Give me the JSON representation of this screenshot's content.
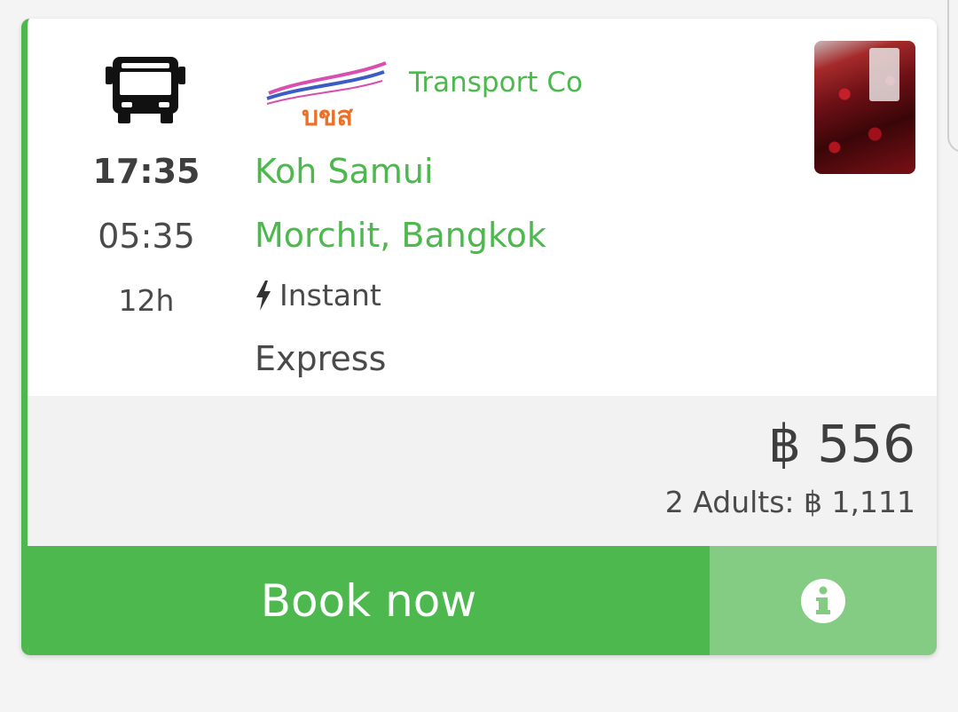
{
  "trip": {
    "departure_time": "17:35",
    "arrival_time": "05:35",
    "duration": "12h",
    "operator": "Transport Co",
    "logo_text": "บขส",
    "from": "Koh Samui",
    "to": "Morchit, Bangkok",
    "booking_type": "Instant",
    "class": "Express",
    "icons": [
      "bus-icon",
      "lightning-icon",
      "info-icon"
    ]
  },
  "pricing": {
    "price": "฿ 556",
    "total": "2 Adults: ฿ 1,111"
  },
  "actions": {
    "book_label": "Book now"
  },
  "colors": {
    "accent": "#4db84e",
    "accent_light": "#84cc84",
    "text": "#3e3e3e",
    "price_bg": "#f2f2f2"
  }
}
